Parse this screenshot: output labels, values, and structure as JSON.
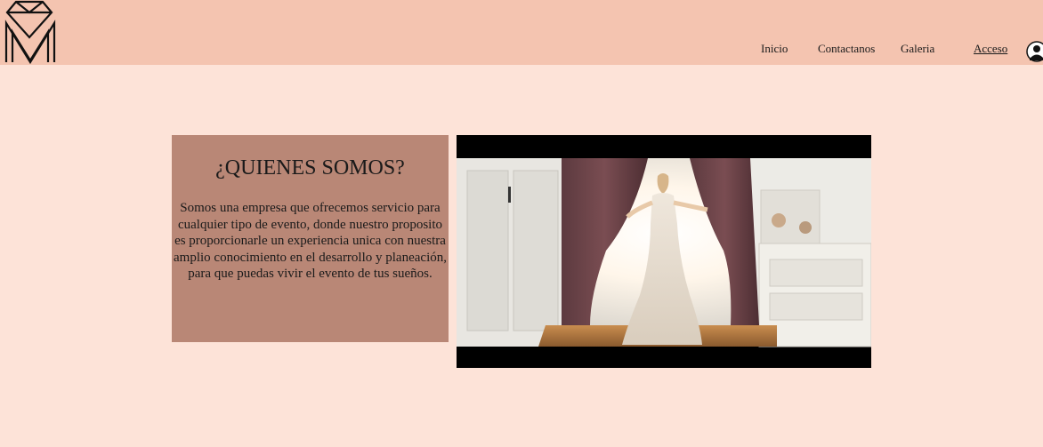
{
  "header": {
    "logo_icon": "diamond-monogram-logo-icon",
    "nav": {
      "inicio": "Inicio",
      "contactanos": "Contactanos",
      "galeria": "Galeria",
      "acceso": "Acceso"
    },
    "user_icon": "user-avatar-icon"
  },
  "about": {
    "title": "¿QUIENES SOMOS?",
    "text": "Somos una empresa que ofrecemos servicio para cualquier tipo de evento, donde nuestro proposito es proporcionarle un experiencia unica con nuestra amplio conocimiento en el desarrollo y planeación, para que puedas vivir el evento de tus sueños."
  },
  "media": {
    "image_subject": "bride-in-lace-wedding-dress-opening-curtains"
  },
  "colors": {
    "header_bg": "#f4c4b0",
    "page_bg": "#fde3d8",
    "card_bg": "#b98776"
  }
}
